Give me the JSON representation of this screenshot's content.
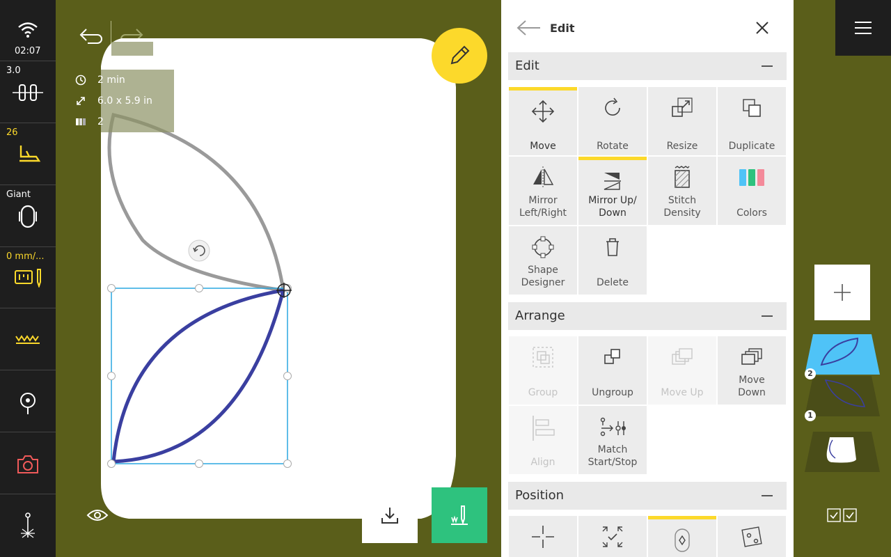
{
  "status": {
    "time": "02:07",
    "needle_label": "3.0",
    "foot_label": "26",
    "hoop_label": "Giant",
    "speed_label": "0 mm/..."
  },
  "canvas": {
    "info": {
      "time": "2 min",
      "size": "6.0 x 5.9 in",
      "colors": "2"
    }
  },
  "panel": {
    "title": "Edit",
    "sections": {
      "edit": {
        "title": "Edit",
        "tiles": [
          {
            "label": "Move",
            "selected": true
          },
          {
            "label": "Rotate"
          },
          {
            "label": "Resize"
          },
          {
            "label": "Duplicate"
          },
          {
            "label": "Mirror Left/Right",
            "l1": "Mirror",
            "l2": "Left/Right"
          },
          {
            "label": "Mirror Up/ Down",
            "l1": "Mirror Up/",
            "l2": "Down",
            "selected": true
          },
          {
            "label": "Stitch Density",
            "l1": "Stitch",
            "l2": "Density"
          },
          {
            "label": "Colors"
          },
          {
            "label": "Shape Designer",
            "l1": "Shape",
            "l2": "Designer"
          },
          {
            "label": "Delete"
          }
        ]
      },
      "arrange": {
        "title": "Arrange",
        "tiles": [
          {
            "label": "Group",
            "disabled": true
          },
          {
            "label": "Ungroup"
          },
          {
            "label": "Move Up",
            "disabled": true
          },
          {
            "label": "Move Down",
            "l1": "Move",
            "l2": "Down"
          },
          {
            "label": "Align",
            "disabled": true
          },
          {
            "label": "Match Start/Stop",
            "l1": "Match",
            "l2": "Start/Stop"
          }
        ]
      },
      "position": {
        "title": "Position"
      }
    }
  },
  "layers": {
    "badge_2": "2",
    "badge_1": "1"
  },
  "colors": {
    "background": "#5a5e1a",
    "accent_yellow": "#fcd92b",
    "selection_blue": "#2aa7e0",
    "stitch_green": "#2ec27e",
    "thread_blue": "#3a3fa0"
  }
}
